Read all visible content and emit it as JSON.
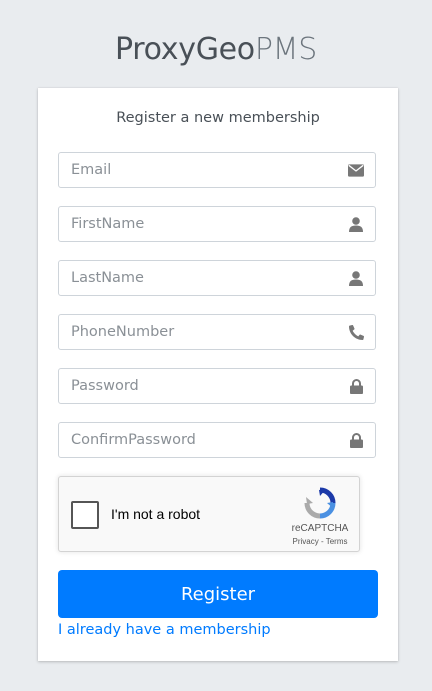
{
  "logo": {
    "strong": "ProxyGeo",
    "light": "PMS"
  },
  "card": {
    "title": "Register a new membership"
  },
  "fields": [
    {
      "placeholder": "Email",
      "icon": "envelope-icon"
    },
    {
      "placeholder": "FirstName",
      "icon": "user-icon"
    },
    {
      "placeholder": "LastName",
      "icon": "user-icon"
    },
    {
      "placeholder": "PhoneNumber",
      "icon": "phone-icon"
    },
    {
      "placeholder": "Password",
      "icon": "lock-icon"
    },
    {
      "placeholder": "ConfirmPassword",
      "icon": "lock-icon"
    }
  ],
  "captcha": {
    "label": "I'm not a robot",
    "brand": "reCAPTCHA",
    "links": "Privacy - Terms"
  },
  "actions": {
    "register_label": "Register",
    "membership_link": "I already have a membership"
  },
  "colors": {
    "primary": "#007bff",
    "background": "#e9ecef",
    "icon": "#777777"
  }
}
